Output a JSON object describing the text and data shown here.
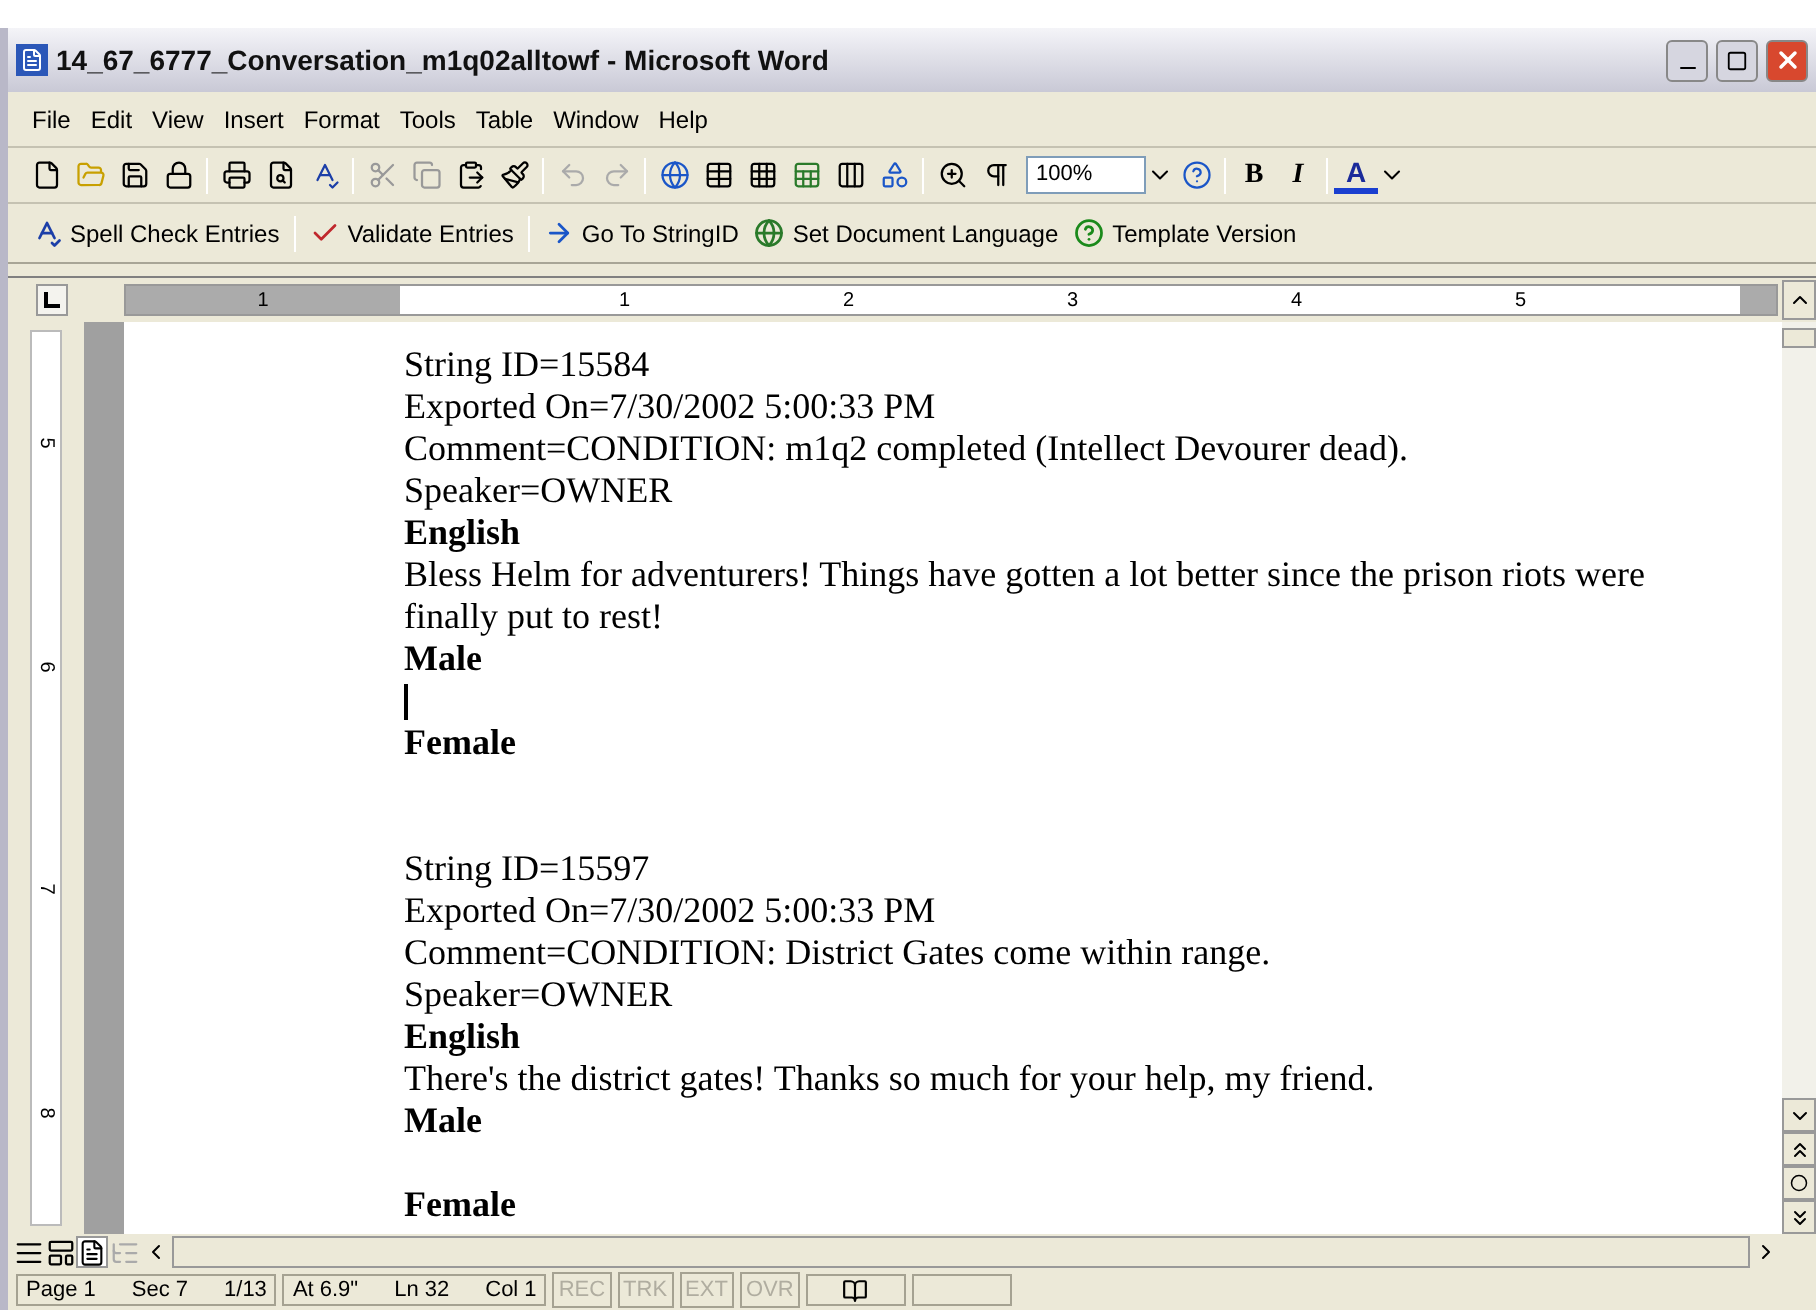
{
  "window": {
    "title": "14_67_6777_Conversation_m1q02alltowf - Microsoft Word"
  },
  "menu": [
    {
      "label": "File"
    },
    {
      "label": "Edit"
    },
    {
      "label": "View"
    },
    {
      "label": "Insert"
    },
    {
      "label": "Format"
    },
    {
      "label": "Tools"
    },
    {
      "label": "Table"
    },
    {
      "label": "Window"
    },
    {
      "label": "Help"
    }
  ],
  "toolbar": {
    "zoom": "100%",
    "bold": "B",
    "italic": "I",
    "font_color": "A"
  },
  "custom_toolbar": [
    {
      "label": "Spell Check Entries",
      "kind": "spell"
    },
    {
      "label": "Validate Entries",
      "kind": "check"
    },
    {
      "label": "Go To StringID",
      "kind": "goto"
    },
    {
      "label": "Set Document Language",
      "kind": "globe"
    },
    {
      "label": "Template Version",
      "kind": "help"
    }
  ],
  "ruler": {
    "horizontal": [
      "1",
      "1",
      "2",
      "3",
      "4",
      "5"
    ],
    "vertical": [
      "5",
      "6",
      "7",
      "8"
    ]
  },
  "document": {
    "paragraphs": [
      {
        "kind": "text",
        "text": "String ID=15584"
      },
      {
        "kind": "text",
        "text": "Exported On=7/30/2002 5:00:33 PM"
      },
      {
        "kind": "text",
        "text": "Comment=CONDITION: m1q2 completed (Intellect Devourer dead)."
      },
      {
        "kind": "text",
        "text": "Speaker=OWNER"
      },
      {
        "kind": "bold",
        "text": "English"
      },
      {
        "kind": "text",
        "text": "Bless Helm for adventurers! Things have gotten a lot better since the prison riots were finally put to rest!"
      },
      {
        "kind": "bold",
        "text": "Male"
      },
      {
        "kind": "caret"
      },
      {
        "kind": "bold",
        "text": "Female"
      },
      {
        "kind": "gap"
      },
      {
        "kind": "gap"
      },
      {
        "kind": "text",
        "text": "String ID=15597"
      },
      {
        "kind": "text",
        "text": "Exported On=7/30/2002 5:00:33 PM"
      },
      {
        "kind": "text",
        "text": "Comment=CONDITION: District Gates come within range."
      },
      {
        "kind": "text",
        "text": "Speaker=OWNER"
      },
      {
        "kind": "bold",
        "text": "English"
      },
      {
        "kind": "text",
        "text": "There's the district gates! Thanks so much for your help, my friend."
      },
      {
        "kind": "bold",
        "text": "Male"
      },
      {
        "kind": "gap"
      },
      {
        "kind": "bold",
        "text": "Female"
      }
    ]
  },
  "status_bar": [
    {
      "items": [
        {
          "text": "Page 1"
        },
        {
          "text": "Sec 7"
        },
        {
          "text": "1/13"
        }
      ]
    },
    {
      "items": [
        {
          "text": "At 6.9\""
        },
        {
          "text": "Ln 32"
        },
        {
          "text": "Col 1"
        }
      ]
    },
    {
      "items": [
        {
          "text": "REC",
          "disabled": true
        },
        {
          "text": "TRK",
          "disabled": true
        },
        {
          "text": "EXT",
          "disabled": true
        },
        {
          "text": "OVR",
          "disabled": true
        }
      ]
    }
  ]
}
